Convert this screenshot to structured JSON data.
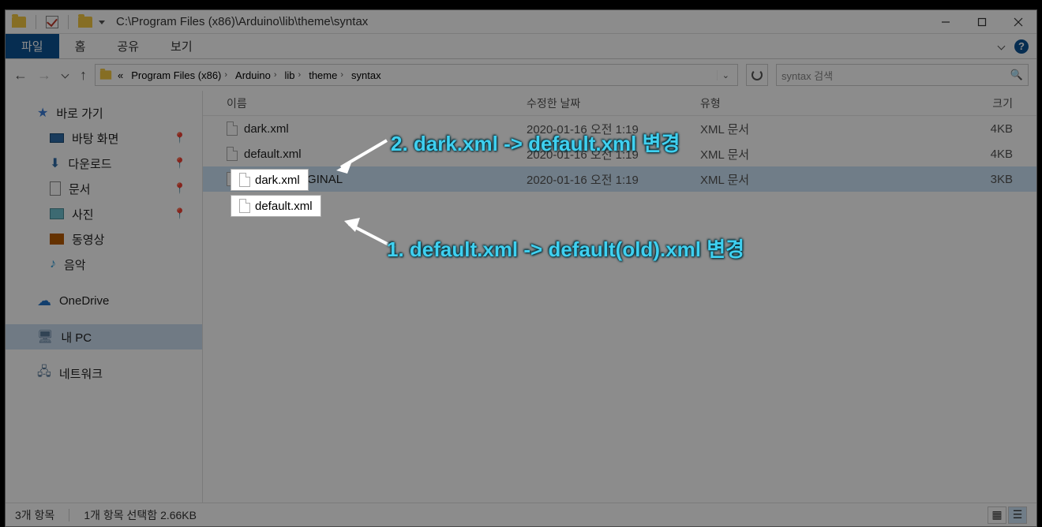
{
  "window": {
    "title_path": "C:\\Program Files (x86)\\Arduino\\lib\\theme\\syntax"
  },
  "ribbon": {
    "file": "파일",
    "home": "홈",
    "share": "공유",
    "view": "보기"
  },
  "breadcrumb": {
    "prefix": "«",
    "segments": [
      "Program Files (x86)",
      "Arduino",
      "lib",
      "theme",
      "syntax"
    ]
  },
  "search": {
    "placeholder": "syntax 검색"
  },
  "sidebar": {
    "quick_access": "바로 가기",
    "desktop": "바탕 화면",
    "downloads": "다운로드",
    "documents": "문서",
    "pictures": "사진",
    "videos": "동영상",
    "music": "음악",
    "onedrive": "OneDrive",
    "this_pc": "내 PC",
    "network": "네트워크"
  },
  "columns": {
    "name": "이름",
    "date": "수정한 날짜",
    "type": "유형",
    "size": "크기"
  },
  "files": [
    {
      "name": "dark.xml",
      "date": "2020-01-16 오전 1:19",
      "type": "XML 문서",
      "size": "4KB"
    },
    {
      "name": "default.xml",
      "date": "2020-01-16 오전 1:19",
      "type": "XML 문서",
      "size": "4KB"
    },
    {
      "name": "default_ORIGINAL",
      "date": "2020-01-16 오전 1:19",
      "type": "XML 문서",
      "size": "3KB"
    }
  ],
  "statusbar": {
    "items": "3개 항목",
    "selected": "1개 항목 선택함 2.66KB"
  },
  "annotations": {
    "line1": "2. dark.xml -> default.xml 변경",
    "line2": "1. default.xml -> default(old).xml 변경"
  }
}
